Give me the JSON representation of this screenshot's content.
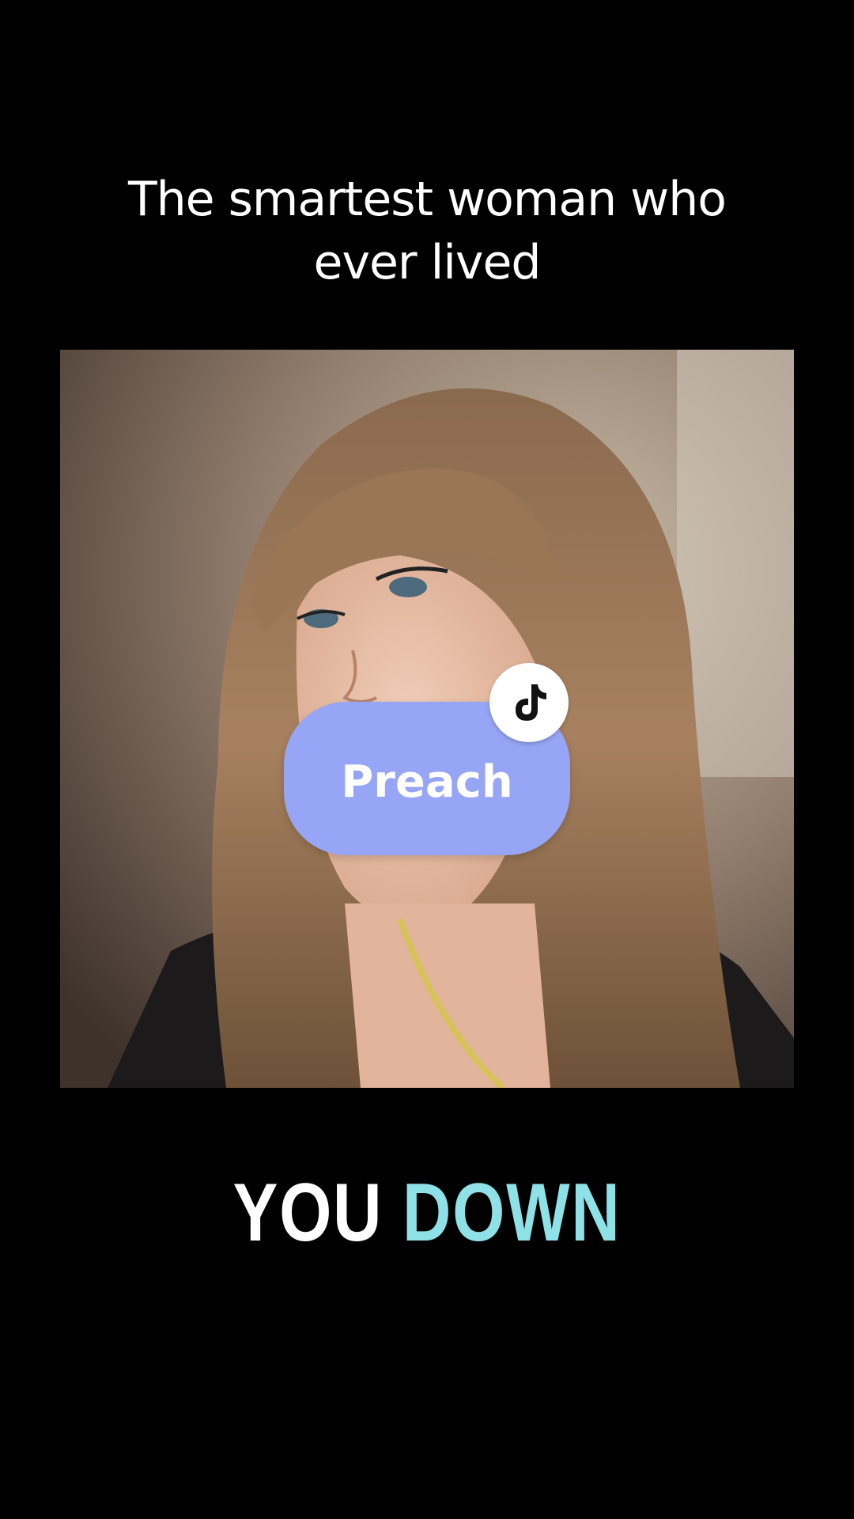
{
  "caption": {
    "line1": "The smartest woman who",
    "line2": "ever lived"
  },
  "photo": {
    "description_icon": "portrait-photo"
  },
  "sticker": {
    "label": "Preach",
    "color": "#96a5f5",
    "badge_icon": "tiktok-logo-icon"
  },
  "lyric": {
    "word1": "YOU",
    "word2": "DOWN",
    "word1_color": "#ffffff",
    "word2_color": "#8fe1e8"
  }
}
